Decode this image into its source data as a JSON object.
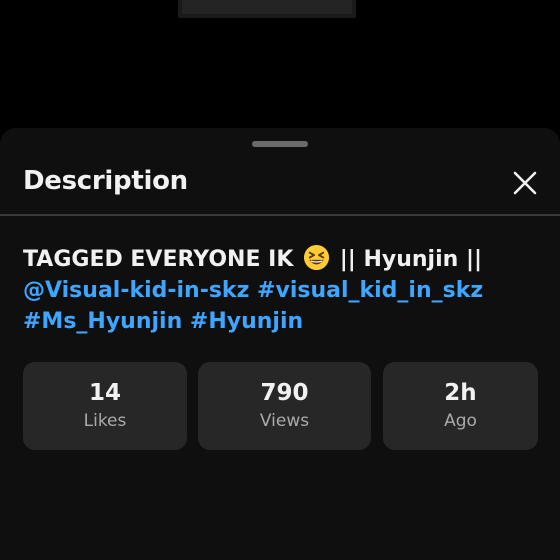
{
  "sheet": {
    "title": "Description",
    "close_icon": "close-icon"
  },
  "description": {
    "line1_text": "TAGGED EVERYONE IK",
    "line1_emoji": "grinning-squinting-face-emoji",
    "line1_suffix": "|| Hyunjin ||",
    "mention": "@Visual-kid-in-skz",
    "hashtags": [
      "#visual_kid_in_skz",
      "#Ms_Hyunjin",
      "#Hyunjin"
    ]
  },
  "stats": [
    {
      "value": "14",
      "label": "Likes"
    },
    {
      "value": "790",
      "label": "Views"
    },
    {
      "value": "2h",
      "label": "Ago"
    }
  ],
  "colors": {
    "background": "#000000",
    "sheet": "#0f0f0f",
    "card": "#272727",
    "link": "#3ea6ff",
    "text": "#f1f1f1",
    "secondary_text": "#aaaaaa"
  }
}
